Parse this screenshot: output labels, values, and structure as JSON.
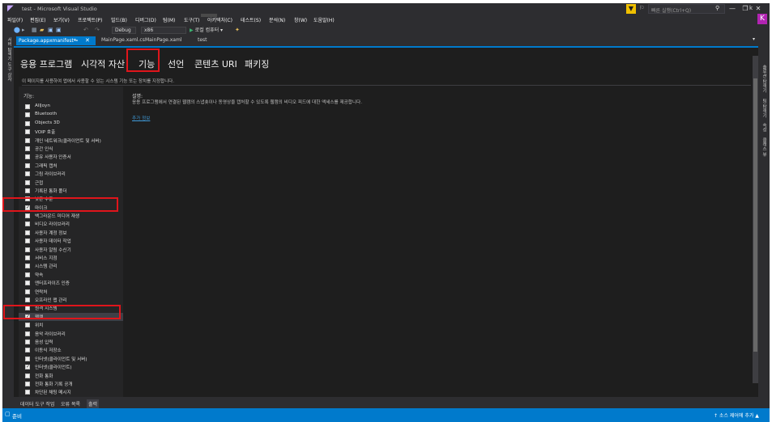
{
  "window": {
    "title": "test - Microsoft Visual Studio",
    "quick_launch_placeholder": "빠른 실행(Ctrl+Q)",
    "user_initial": "k",
    "avatar_letter": "K"
  },
  "menu": [
    {
      "label": "파일(F)"
    },
    {
      "label": "편집(E)"
    },
    {
      "label": "보기(V)"
    },
    {
      "label": "프로젝트(P)"
    },
    {
      "label": "빌드(B)"
    },
    {
      "label": "디버그(D)"
    },
    {
      "label": "팀(M)"
    },
    {
      "label": "도구(T)"
    },
    {
      "label": "아키텍처(C)"
    },
    {
      "label": "테스트(S)"
    },
    {
      "label": "분석(N)"
    },
    {
      "label": "창(W)"
    },
    {
      "label": "도움말(H)"
    }
  ],
  "toolbar": {
    "configuration": "Debug",
    "platform": "x86",
    "run_label": "로컬 컴퓨터"
  },
  "side_left": {
    "label": "서버 탐색기 도구 상자"
  },
  "side_right": {
    "labels": [
      "솔루션 탐색기",
      "팀 탐색기",
      "속성",
      "클래스 뷰"
    ]
  },
  "doc_tabs": [
    {
      "label": "Package.appxmanifest*"
    },
    {
      "label": "MainPage.xaml.cs"
    },
    {
      "label": "MainPage.xaml"
    },
    {
      "label": "test"
    }
  ],
  "designer": {
    "tabs": [
      {
        "label": "응용 프로그램"
      },
      {
        "label": "시각적 자산"
      },
      {
        "label": "기능"
      },
      {
        "label": "선언"
      },
      {
        "label": "콘텐츠 URI"
      },
      {
        "label": "패키징"
      }
    ],
    "caption": "이 페이지를 사용하여 앱에서 사용할 수 있는 시스템 기능 또는 장치를 지정합니다.",
    "capabilities_header": "기능:",
    "capabilities": [
      {
        "label": "AllJoyn",
        "checked": false
      },
      {
        "label": "Bluetooth",
        "checked": false
      },
      {
        "label": "Objects 3D",
        "checked": false
      },
      {
        "label": "VOIP 호출",
        "checked": false
      },
      {
        "label": "개인 네트워크(클라이언트 및 서버)",
        "checked": false
      },
      {
        "label": "공간 인식",
        "checked": false
      },
      {
        "label": "공유 사용자 인증서",
        "checked": false
      },
      {
        "label": "그래픽 캡처",
        "checked": false
      },
      {
        "label": "그림 라이브러리",
        "checked": false
      },
      {
        "label": "근접",
        "checked": false
      },
      {
        "label": "기록된 통화 폴더",
        "checked": false
      },
      {
        "label": "낮은 수준",
        "checked": false
      },
      {
        "label": "마이크",
        "checked": true
      },
      {
        "label": "백그라운드 미디어 재생",
        "checked": false
      },
      {
        "label": "비디오 라이브러리",
        "checked": false
      },
      {
        "label": "사용자 계정 정보",
        "checked": false
      },
      {
        "label": "사용자 데이터 작업",
        "checked": false
      },
      {
        "label": "사용자 알림 수신기",
        "checked": false
      },
      {
        "label": "서비스 지점",
        "checked": false
      },
      {
        "label": "시스템 관리",
        "checked": false
      },
      {
        "label": "약속",
        "checked": false
      },
      {
        "label": "엔터프라이즈 인증",
        "checked": false
      },
      {
        "label": "연락처",
        "checked": false
      },
      {
        "label": "오프라인 맵 관리",
        "checked": false
      },
      {
        "label": "원격 시스템",
        "checked": false
      },
      {
        "label": "웹캠",
        "checked": true
      },
      {
        "label": "위치",
        "checked": false
      },
      {
        "label": "음악 라이브러리",
        "checked": false
      },
      {
        "label": "음성 입력",
        "checked": false
      },
      {
        "label": "이동식 저장소",
        "checked": false
      },
      {
        "label": "인터넷(클라이언트 및 서버)",
        "checked": false
      },
      {
        "label": "인터넷(클라이언트)",
        "checked": true
      },
      {
        "label": "전화 통화",
        "checked": false
      },
      {
        "label": "전화 통화 기록 공개",
        "checked": false
      },
      {
        "label": "차단된 채팅 메시지",
        "checked": false
      }
    ],
    "selected_index": 25,
    "description_header": "설명:",
    "description": "응용 프로그램에서 연결된 웹캠의 스냅숏이나 동영상을 캡처할 수 있도록 웹캠의 비디오 피드에 대한 액세스를 제공합니다.",
    "more_info": "추가 정보"
  },
  "bottom_tabs": [
    {
      "label": "데이터 도구 작업"
    },
    {
      "label": "오류 목록"
    },
    {
      "label": "출력"
    }
  ],
  "status": {
    "ready": "준비",
    "source_control": "↑ 소스 제어에 추가 ▲"
  },
  "colors": {
    "accent": "#007acc",
    "annotation": "#e0151b",
    "avatar": "#b224b2"
  }
}
